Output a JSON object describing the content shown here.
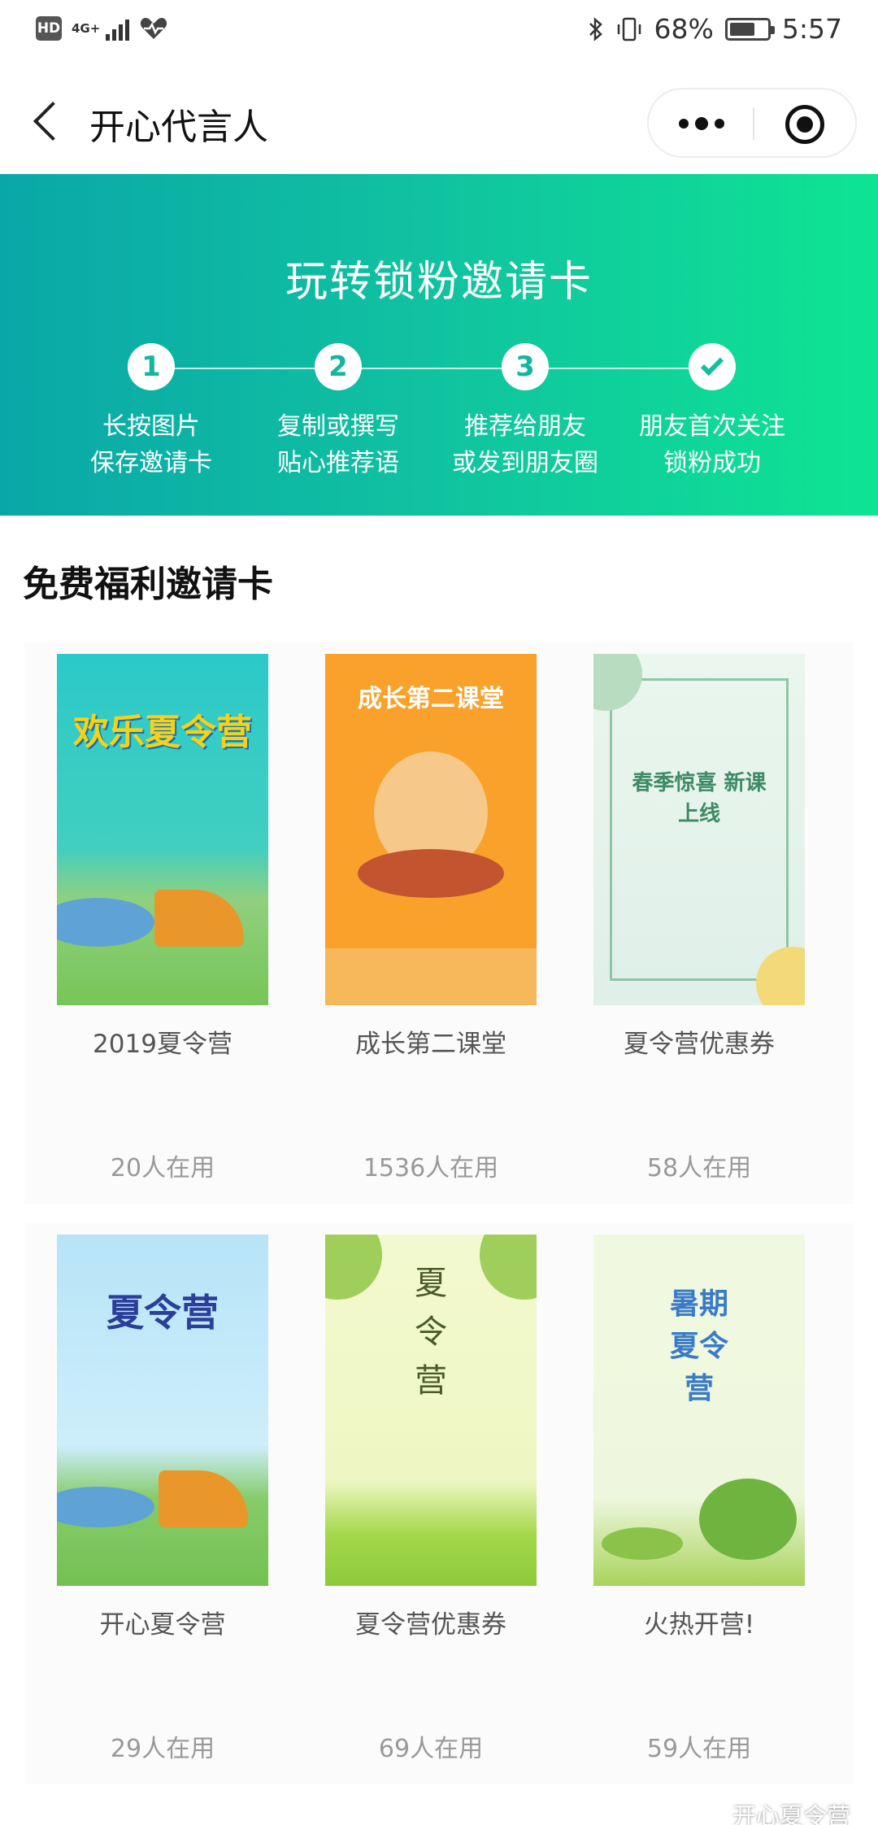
{
  "status_bar": {
    "hd": "HD",
    "network": "4G+",
    "battery": "68%",
    "battery_level": 0.68,
    "time": "5:57"
  },
  "nav": {
    "title": "开心代言人"
  },
  "banner": {
    "title": "玩转锁粉邀请卡",
    "steps": [
      {
        "number": "1",
        "line1": "长按图片",
        "line2": "保存邀请卡"
      },
      {
        "number": "2",
        "line1": "复制或撰写",
        "line2": "贴心推荐语"
      },
      {
        "number": "3",
        "line1": "推荐给朋友",
        "line2": "或发到朋友圈"
      },
      {
        "number": "",
        "line1": "朋友首次关注",
        "line2": "锁粉成功"
      }
    ]
  },
  "section": {
    "title": "免费福利邀请卡"
  },
  "cards": [
    {
      "name": "2019夏令营",
      "count": "20人在用",
      "poster_text": "欢乐夏令营"
    },
    {
      "name": "成长第二课堂",
      "count": "1536人在用",
      "poster_text": "成长第二课堂"
    },
    {
      "name": "夏令营优惠券",
      "count": "58人在用",
      "poster_text": "春季惊喜 新课上线"
    },
    {
      "name": "开心夏令营",
      "count": "29人在用",
      "poster_text": "夏令营"
    },
    {
      "name": "夏令营优惠券",
      "count": "69人在用",
      "poster_text": "夏令营"
    },
    {
      "name": "火热开营!",
      "count": "59人在用",
      "poster_text": "暑期夏令营"
    }
  ],
  "watermark": "开心夏令营"
}
